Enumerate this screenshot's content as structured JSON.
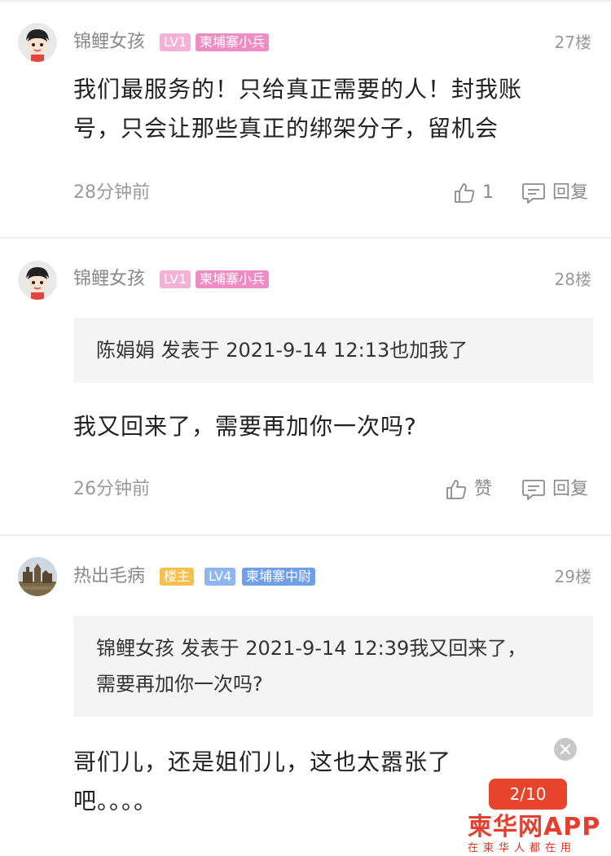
{
  "comments": [
    {
      "username": "锦鲤女孩",
      "badges": [
        {
          "label": "LV1",
          "color": "#f3b1d4"
        },
        {
          "label": "柬埔寨小兵",
          "color": "#ef8cc4"
        }
      ],
      "floor": "27楼",
      "content_lines": [
        "我们最服务的！只给真正需要的人！封我账",
        "号，只会让那些真正的绑架分子，留机会"
      ],
      "time": "28分钟前",
      "like_label": "1",
      "reply_label": "回复"
    },
    {
      "username": "锦鲤女孩",
      "badges": [
        {
          "label": "LV1",
          "color": "#f3b1d4"
        },
        {
          "label": "柬埔寨小兵",
          "color": "#ef8cc4"
        }
      ],
      "floor": "28楼",
      "quote_lines": [
        "陈娟娟 发表于 2021-9-14 12:13也加我了"
      ],
      "content_lines": [
        "我又回来了，需要再加你一次吗?"
      ],
      "time": "26分钟前",
      "like_label": "赞",
      "reply_label": "回复"
    },
    {
      "username": "热出毛病",
      "badges": [
        {
          "label": "楼主",
          "color": "#f5c04e"
        },
        {
          "label": "LV4",
          "color": "#8fb6ee"
        },
        {
          "label": "柬埔寨中尉",
          "color": "#6f9fe6"
        }
      ],
      "floor": "29楼",
      "quote_lines": [
        "锦鲤女孩 发表于 2021-9-14 12:39我又回来了，",
        "需要再加你一次吗?"
      ],
      "content_lines": [
        "哥们儿，还是姐们儿，这也太嚣张了",
        "吧。。。。"
      ]
    }
  ],
  "pager": {
    "label": "2/10"
  },
  "watermark": {
    "main": "柬华网APP",
    "sub": "在柬华人都在用"
  },
  "colors": {
    "accent": "#e8432b"
  }
}
